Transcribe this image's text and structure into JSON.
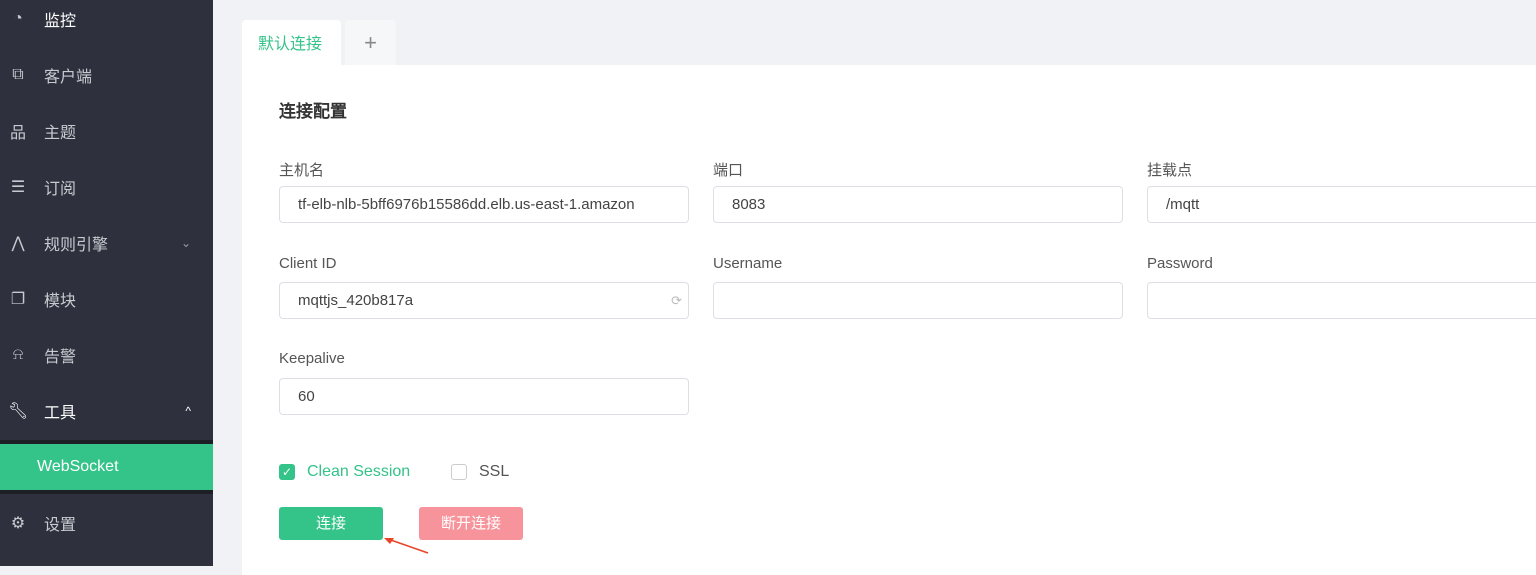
{
  "sidebar": {
    "items": [
      {
        "label": "监控",
        "icon": "dashboard-icon"
      },
      {
        "label": "客户端",
        "icon": "clients-icon"
      },
      {
        "label": "主题",
        "icon": "topics-icon"
      },
      {
        "label": "订阅",
        "icon": "subscriptions-icon"
      },
      {
        "label": "规则引擎",
        "icon": "rule-engine-icon"
      },
      {
        "label": "模块",
        "icon": "modules-icon"
      },
      {
        "label": "告警",
        "icon": "alarm-icon"
      },
      {
        "label": "工具",
        "icon": "wrench-icon"
      },
      {
        "label": "设置",
        "icon": "gear-icon"
      }
    ],
    "sub_item": "WebSocket",
    "accent": "#34c388"
  },
  "tabs": {
    "active": "默认连接",
    "add": "+"
  },
  "form": {
    "title": "连接配置",
    "host_label": "主机名",
    "host_value": "tf-elb-nlb-5bff6976b15586dd.elb.us-east-1.amazon",
    "port_label": "端口",
    "port_value": "8083",
    "path_label": "挂载点",
    "path_value": "/mqtt",
    "client_id_label": "Client ID",
    "client_id_value": "mqttjs_420b817a",
    "username_label": "Username",
    "username_value": "",
    "password_label": "Password",
    "password_value": "",
    "keepalive_label": "Keepalive",
    "keepalive_value": "60",
    "clean_session_label": "Clean Session",
    "clean_session_checked": true,
    "ssl_label": "SSL",
    "ssl_checked": false,
    "connect_label": "连接",
    "disconnect_label": "断开连接"
  }
}
